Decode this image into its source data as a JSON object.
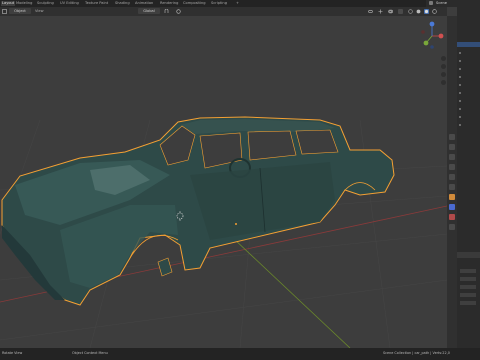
{
  "workspace_tabs": [
    {
      "label": "Layout",
      "active": true
    },
    {
      "label": "Modeling"
    },
    {
      "label": "Sculpting"
    },
    {
      "label": "UV Editing"
    },
    {
      "label": "Texture Paint"
    },
    {
      "label": "Shading"
    },
    {
      "label": "Animation"
    },
    {
      "label": "Rendering"
    },
    {
      "label": "Compositing"
    },
    {
      "label": "Scripting"
    }
  ],
  "scene_label": "Scene",
  "header": {
    "mode_label": "Object",
    "transform_orientation": "Global"
  },
  "statusbar": {
    "left": "Rotate View",
    "middle": "Object Context Menu",
    "right": "Scene Collection | car_path | Verts:22,0"
  },
  "colors": {
    "accent_selected": "#f5a033",
    "viewport_bg": "#3d3d3d",
    "grid_x_axis": "#8a3a3a",
    "grid_y_axis": "#6b8a2a",
    "car_body": "#2e4a48"
  }
}
